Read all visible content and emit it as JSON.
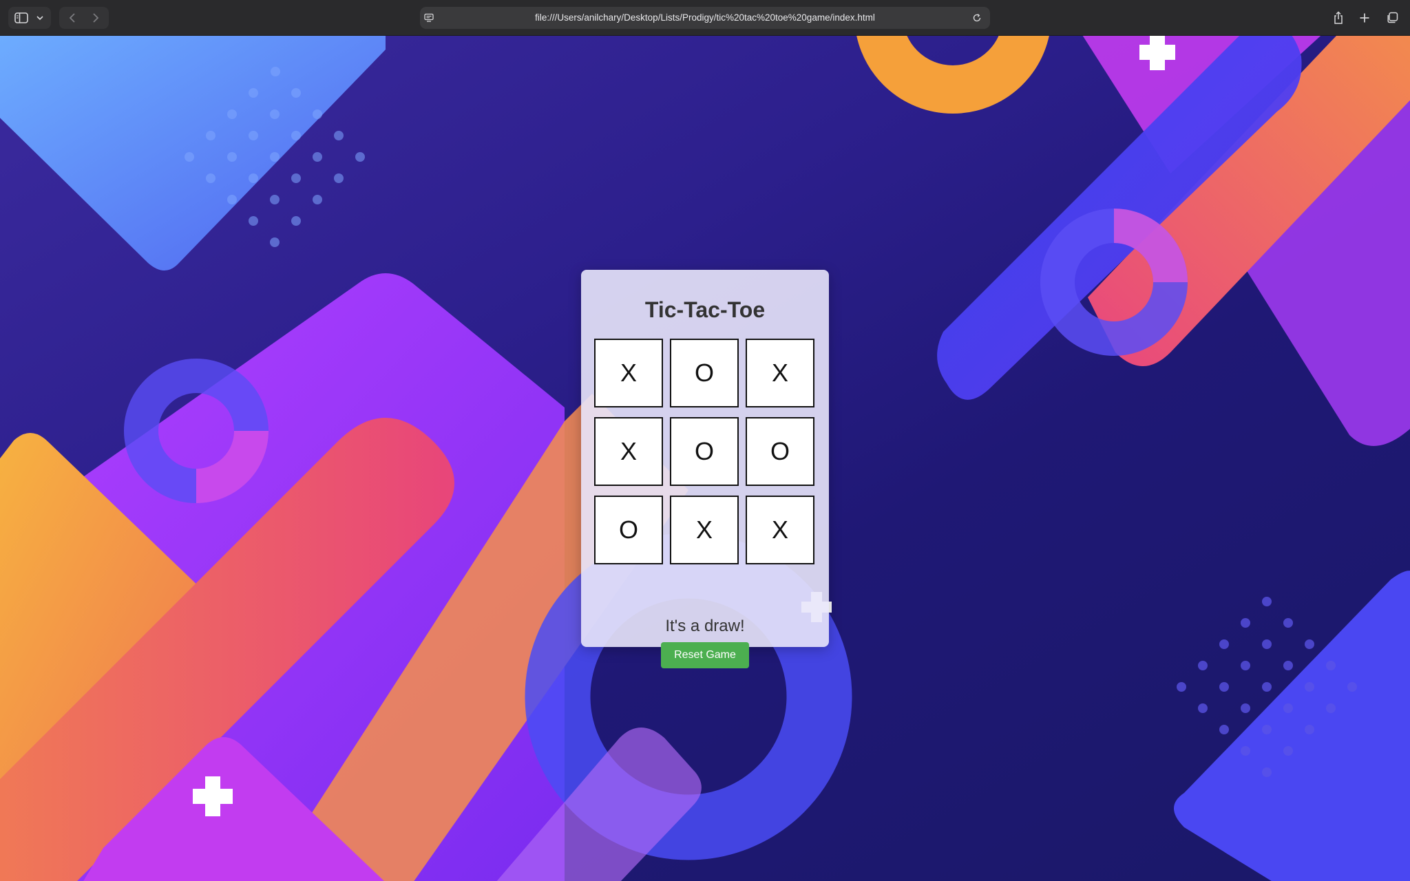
{
  "browser": {
    "url": "file:///Users/anilchary/Desktop/Lists/Prodigy/tic%20tac%20toe%20game/index.html"
  },
  "game": {
    "title": "Tic-Tac-Toe",
    "board": [
      [
        "X",
        "O",
        "X"
      ],
      [
        "X",
        "O",
        "O"
      ],
      [
        "O",
        "X",
        "X"
      ]
    ],
    "status": "It's a draw!",
    "reset_label": "Reset Game"
  },
  "colors": {
    "reset_button": "#4caf50",
    "card_background": "#e8e6fa"
  }
}
